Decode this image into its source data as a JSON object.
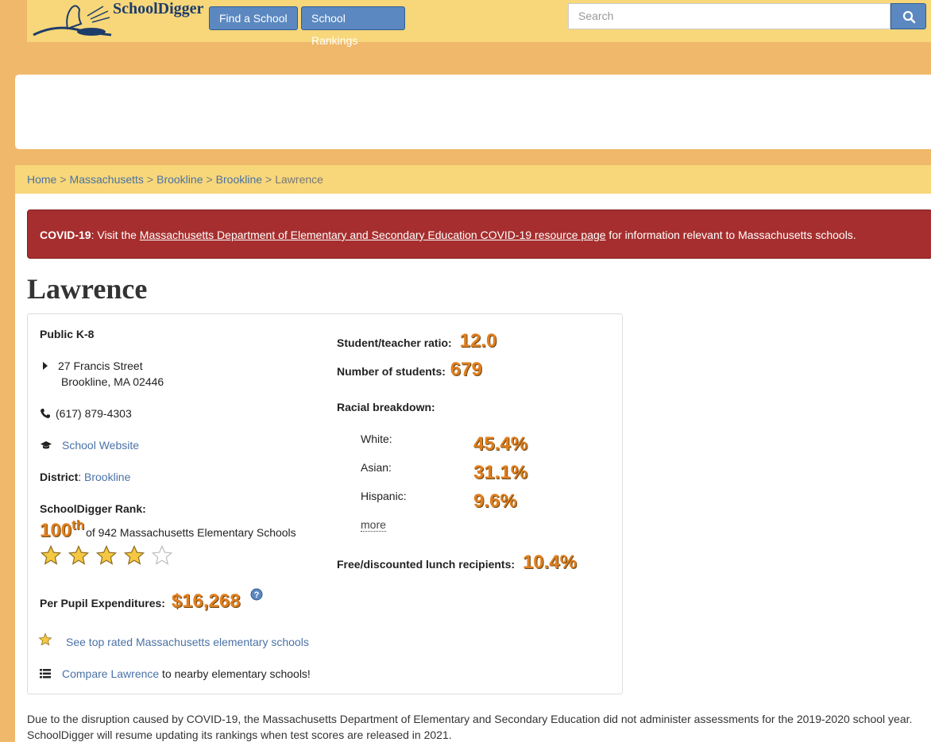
{
  "header": {
    "logo_text": "SchoolDigger",
    "nav": [
      "Find a School",
      "School Rankings"
    ],
    "search_placeholder": "Search"
  },
  "breadcrumb": [
    "Home",
    "Massachusetts",
    "Brookline",
    "Brookline",
    "Lawrence"
  ],
  "covid": {
    "prefix": "COVID-19",
    "text1": ": Visit the ",
    "link": "Massachusetts Department of Elementary and Secondary Education COVID-19 resource page",
    "text2": " for information relevant to Massachusetts schools."
  },
  "school": {
    "name": "Lawrence",
    "type": "Public K-8",
    "address_line1": "27 Francis Street",
    "address_line2": "Brookline, MA  02446",
    "phone": "(617) 879-4303",
    "website_label": "School Website",
    "district_label": "District",
    "district_sep": ":",
    "district_value": "Brookline",
    "rank_label": "SchoolDigger Rank:",
    "rank_value": "100",
    "rank_suffix": "th",
    "rank_text": "of 942 Massachusetts Elementary Schools",
    "stars_filled": 4,
    "stars_total": 5,
    "ppe_label": "Per Pupil Expenditures:",
    "ppe_value": "$16,268",
    "top_rated_link": "See top rated Massachusetts elementary schools",
    "compare_link": "Compare Lawrence",
    "compare_text": " to nearby elementary schools!",
    "ratio_label": "Student/teacher ratio:",
    "ratio_value": "12.0",
    "students_label": "Number of students:",
    "students_value": "679",
    "racial_label": "Racial breakdown:",
    "racial": [
      {
        "name": "White:",
        "value": "45.4%"
      },
      {
        "name": "Asian:",
        "value": "31.1%"
      },
      {
        "name": "Hispanic:",
        "value": "9.6%"
      }
    ],
    "more_link": "more",
    "lunch_label": "Free/discounted lunch recipients:",
    "lunch_value": "10.4%"
  },
  "footnote": "Due to the disruption caused by COVID-19, the Massachusetts Department of Elementary and Secondary Education did not administer assessments for the 2019-2020 school year. SchoolDigger will resume updating its rankings when test scores are released in 2021.",
  "colors": {
    "page_bg": "#f0b86a",
    "header_bg": "#f7d77a",
    "button_blue": "#5b88c0",
    "covid_red": "#a62e2e",
    "stat_orange": "#e07f1f",
    "link_blue": "#4a72a6"
  },
  "icons": [
    "search-icon",
    "caret-right-icon",
    "phone-icon",
    "graduation-cap-icon",
    "star-icon",
    "list-icon",
    "help-icon"
  ]
}
